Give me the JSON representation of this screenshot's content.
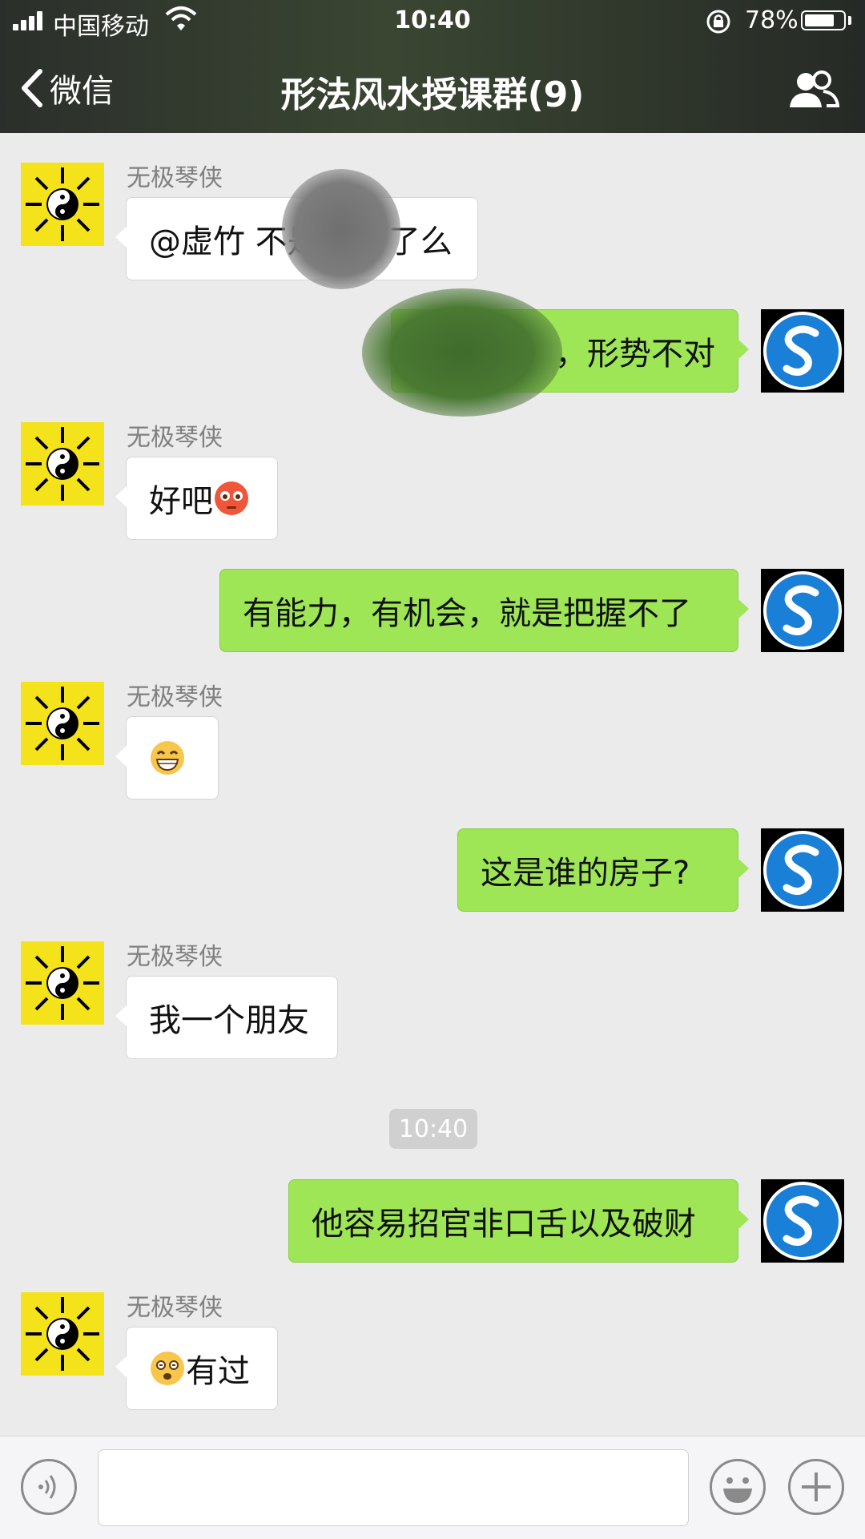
{
  "status_bar": {
    "carrier": "中国移动",
    "time": "10:40",
    "battery": "78%",
    "battery_level": 0.78
  },
  "nav": {
    "back_label": "微信",
    "title": "形法风水授课群(9)"
  },
  "messages": [
    {
      "side": "in",
      "sender": "无极琴侠",
      "text": "@虚竹 不是",
      "text_after": "了么"
    },
    {
      "side": "out",
      "text": "，形势不对"
    },
    {
      "side": "in",
      "sender": "无极琴侠",
      "text": "好吧",
      "emoji": "flushed-face-emoji"
    },
    {
      "side": "out",
      "text": "有能力，有机会，就是把握不了"
    },
    {
      "side": "in",
      "sender": "无极琴侠",
      "emoji": "grinning-face-emoji"
    },
    {
      "side": "out",
      "text": "这是谁的房子?"
    },
    {
      "side": "in",
      "sender": "无极琴侠",
      "text": "我一个朋友"
    },
    {
      "side": "out",
      "text": "他容易招官非口舌以及破财"
    },
    {
      "side": "in",
      "sender": "无极琴侠",
      "text": "有过",
      "emoji": "dizzy-face-emoji"
    }
  ],
  "time_divider": "10:40",
  "input": {
    "placeholder": "",
    "voice_icon": "voice-icon",
    "emoji_icon": "emoji-icon",
    "add_icon": "plus-icon"
  },
  "colors": {
    "outgoing_bubble": "#9ee656",
    "incoming_bubble": "#ffffff",
    "chat_background": "#ebebeb",
    "left_avatar_bg": "#f4e21a"
  }
}
